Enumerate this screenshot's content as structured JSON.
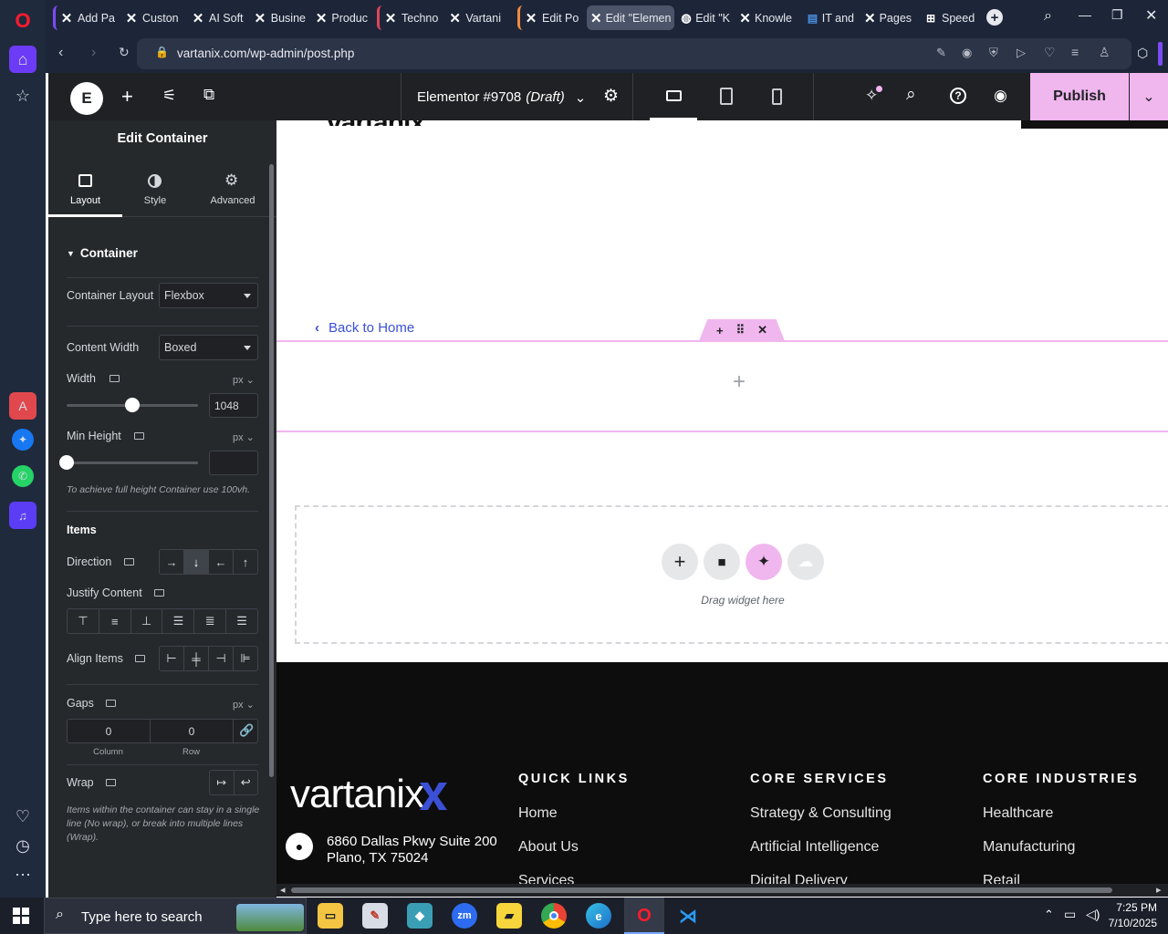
{
  "browser": {
    "tabs": [
      {
        "label": "Add Pa",
        "group_color": ""
      },
      {
        "label": "Custon",
        "group_color": ""
      },
      {
        "label": "AI Soft",
        "group_color": ""
      },
      {
        "label": "Busine",
        "group_color": ""
      },
      {
        "label": "Produc",
        "group_color": ""
      },
      {
        "label": "Techno",
        "group_color": "#e2445c"
      },
      {
        "label": "Vartani",
        "group_color": ""
      },
      {
        "label": "Edit Po",
        "group_color": "#f08a3e"
      },
      {
        "label": "Edit \"Elemen",
        "group_color": ""
      },
      {
        "label": "Edit \"K",
        "group_color": ""
      },
      {
        "label": "Knowle",
        "group_color": ""
      },
      {
        "label": "IT and",
        "group_color": ""
      },
      {
        "label": "Pages",
        "group_color": ""
      },
      {
        "label": "Speed",
        "group_color": ""
      }
    ],
    "url": "vartanix.com/wp-admin/post.php"
  },
  "editor": {
    "doc_title": "Elementor #9708",
    "doc_status": "(Draft)",
    "publish_label": "Publish"
  },
  "panel": {
    "title": "Edit Container",
    "tabs": [
      {
        "label": "Layout"
      },
      {
        "label": "Style"
      },
      {
        "label": "Advanced"
      }
    ],
    "section": "Container",
    "container_layout_label": "Container Layout",
    "container_layout_value": "Flexbox",
    "content_width_label": "Content Width",
    "content_width_value": "Boxed",
    "width_label": "Width",
    "width_unit": "px",
    "width_value": "1048",
    "width_slider_fraction": 0.5,
    "min_height_label": "Min Height",
    "min_height_unit": "px",
    "min_height_value": "",
    "min_height_hint": "To achieve full height Container use 100vh.",
    "items_heading": "Items",
    "direction_label": "Direction",
    "justify_label": "Justify Content",
    "align_label": "Align Items",
    "gaps_label": "Gaps",
    "gaps_unit": "px",
    "gap_column": "0",
    "gap_row": "0",
    "gap_column_label": "Column",
    "gap_row_label": "Row",
    "wrap_label": "Wrap",
    "wrap_hint": "Items within the container can stay in a single line (No wrap), or break into multiple lines (Wrap)."
  },
  "canvas": {
    "back_link": "Back to Home",
    "drag_hint": "Drag widget here",
    "footer": {
      "logo_text": "vartanix",
      "address_line1": "6860 Dallas Pkwy Suite 200",
      "address_line2": "Plano, TX 75024",
      "quick_links_heading": "QUICK LINKS",
      "quick_links": [
        "Home",
        "About Us",
        "Services"
      ],
      "core_services_heading": "CORE SERVICES",
      "core_services": [
        "Strategy & Consulting",
        "Artificial Intelligence",
        "Digital Delivery"
      ],
      "core_industries_heading": "CORE INDUSTRIES",
      "core_industries": [
        "Healthcare",
        "Manufacturing",
        "Retail"
      ]
    }
  },
  "taskbar": {
    "search_placeholder": "Type here to search",
    "time": "7:25 PM",
    "date": "7/10/2025"
  },
  "colors": {
    "accent_pink": "#f0b6ee",
    "elementor_dark": "#26292c",
    "link_blue": "#3b50d6"
  }
}
